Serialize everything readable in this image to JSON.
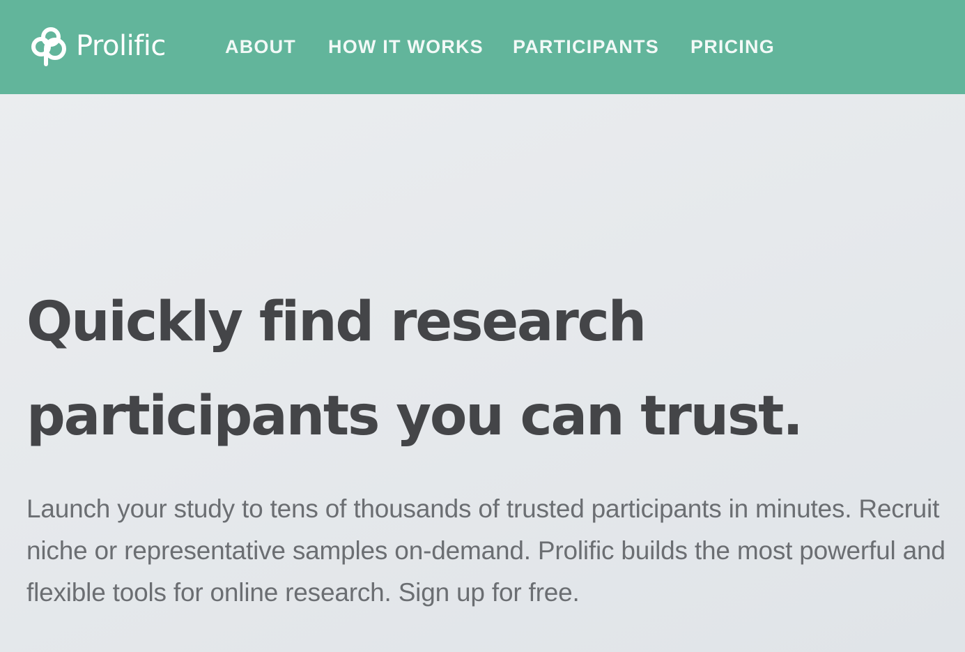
{
  "header": {
    "brand": "Prolific",
    "logo_icon": "prolific-logo-icon",
    "background_color": "#62b59b",
    "nav": [
      {
        "label": "ABOUT"
      },
      {
        "label": "HOW IT WORKS"
      },
      {
        "label": "PARTICIPANTS"
      },
      {
        "label": "PRICING"
      }
    ]
  },
  "hero": {
    "title_line1": "Quickly find research",
    "title_line2": "participants you can trust.",
    "subtitle": "Launch your study to tens of thousands of trusted participants in minutes. Recruit niche or representative samples on-demand. Prolific builds the most powerful and flexible tools for online research. Sign up for free.",
    "title_color": "#444548",
    "text_color": "#6b6e72"
  }
}
